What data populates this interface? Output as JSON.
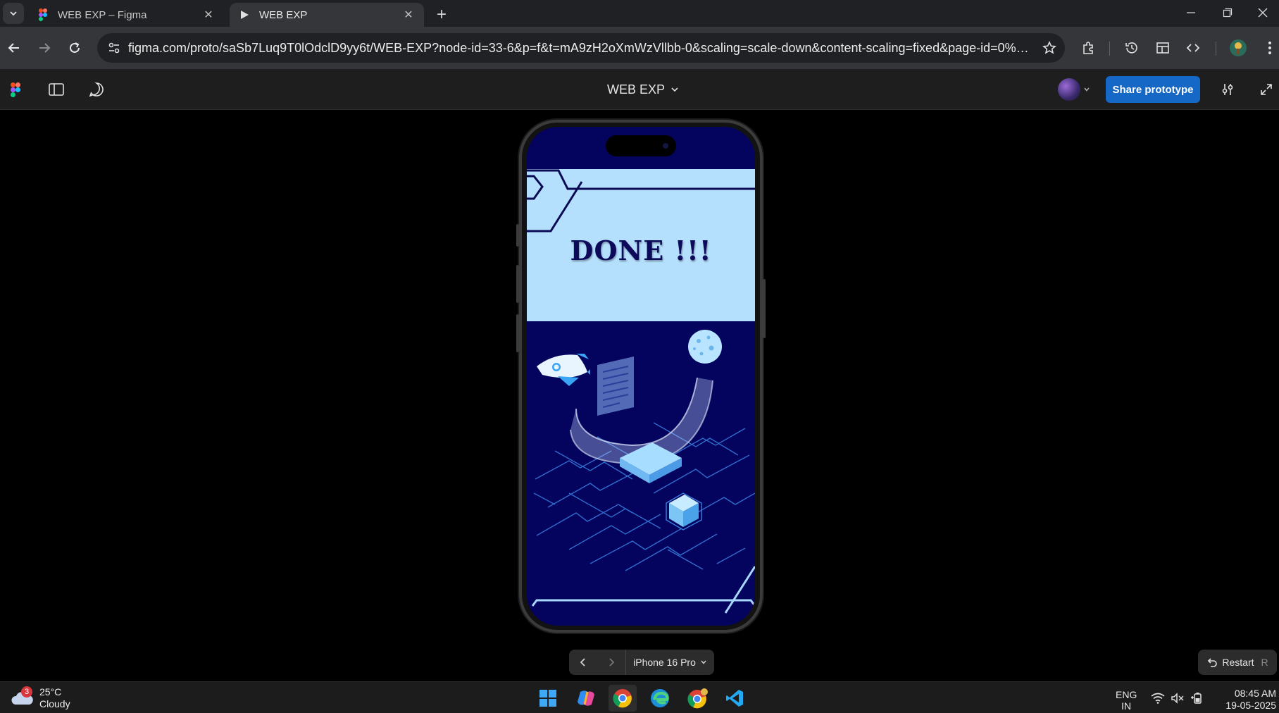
{
  "browser": {
    "tabs": [
      {
        "title": "WEB EXP – Figma",
        "favicon": "figma-logo-icon",
        "active": false
      },
      {
        "title": "WEB EXP",
        "favicon": "play-icon",
        "active": true
      }
    ],
    "url": "figma.com/proto/saSb7Luq9T0lOdclD9yy6t/WEB-EXP?node-id=33-6&p=f&t=mA9zH2oXmWzVllbb-0&scaling=scale-down&content-scaling=fixed&page-id=0%3A1&start..."
  },
  "figma": {
    "file_title": "WEB EXP",
    "share_label": "Share prototype"
  },
  "prototype": {
    "screen_heading": "DONE !!!",
    "device_label": "iPhone 16 Pro",
    "restart_label": "Restart",
    "restart_key": "R",
    "colors": {
      "header_panel": "#b4e0fd",
      "screen_bg": "#04035e",
      "accent_light": "#8fd3ff"
    }
  },
  "taskbar": {
    "weather_badge": "3",
    "temperature": "25°C",
    "condition": "Cloudy",
    "lang_line1": "ENG",
    "lang_line2": "IN",
    "time": "08:45 AM",
    "date": "19-05-2025",
    "apps": [
      "windows-start-icon",
      "copilot-icon",
      "chrome-icon",
      "edge-icon",
      "chrome-profile-icon",
      "vscode-icon"
    ]
  }
}
